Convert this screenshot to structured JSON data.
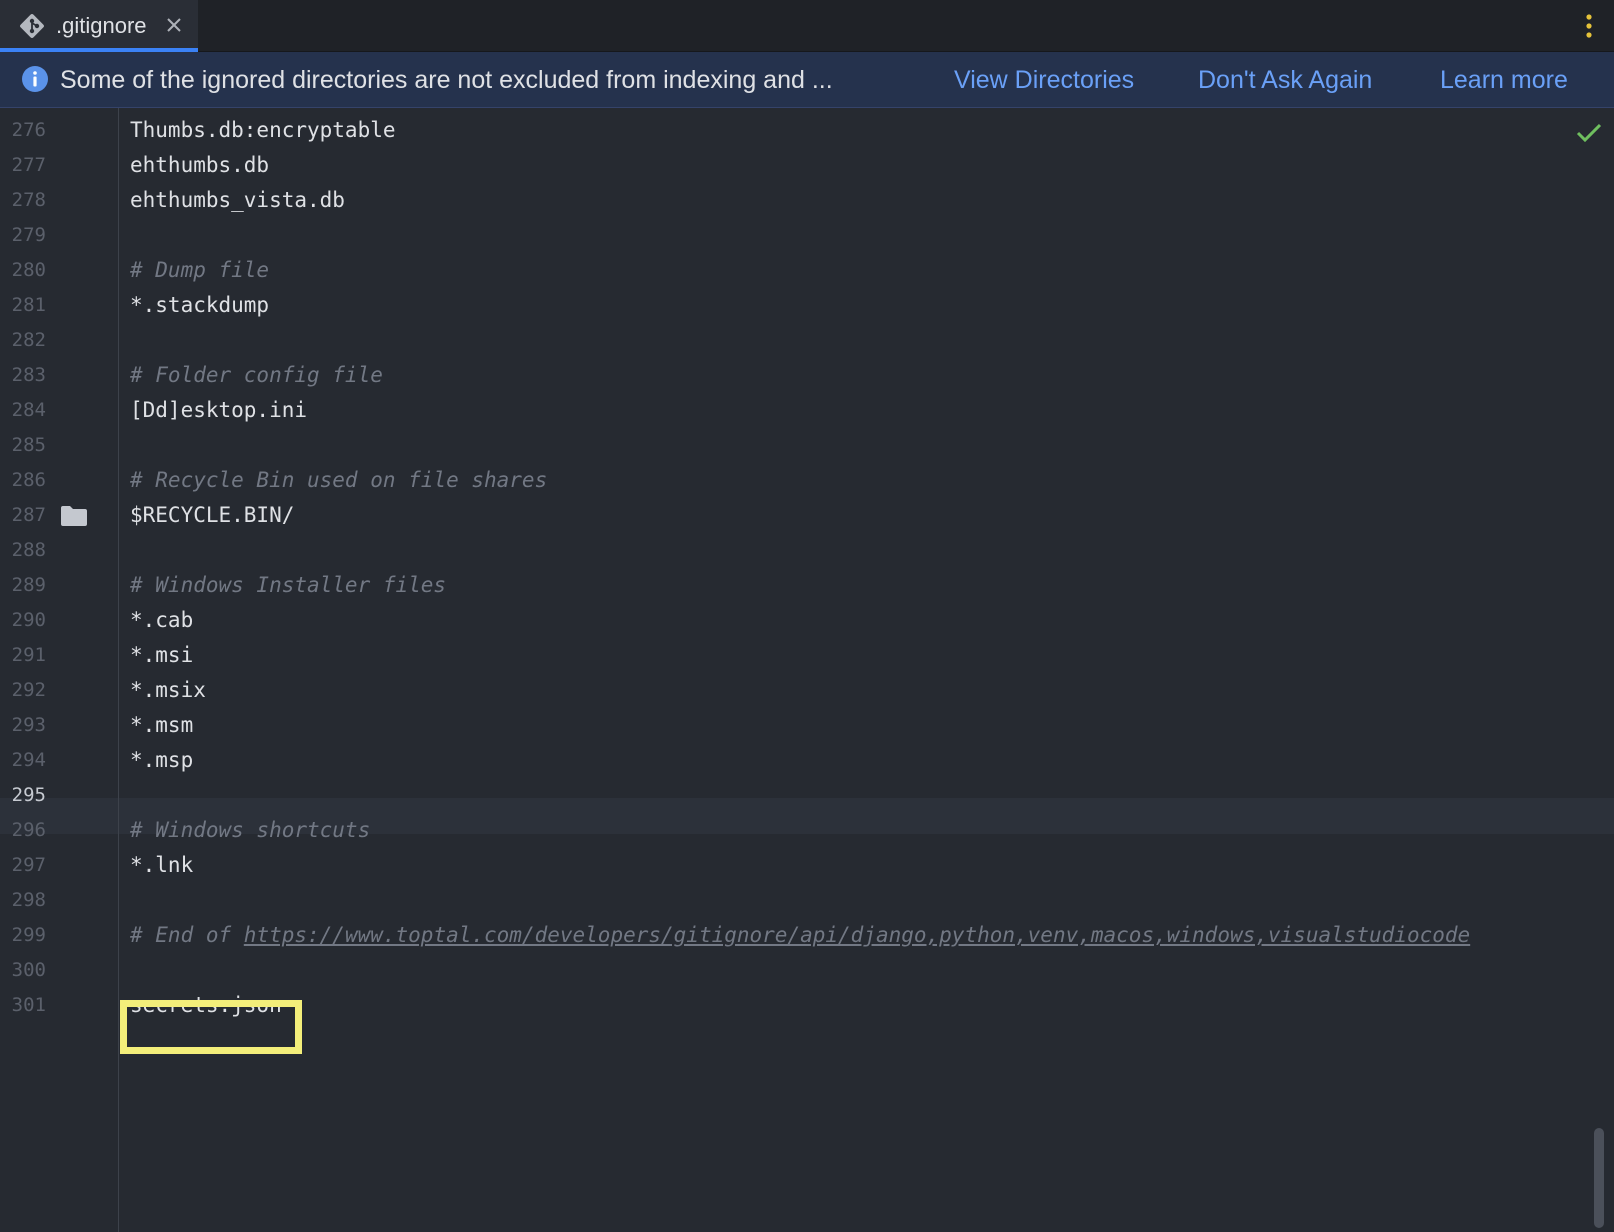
{
  "tab": {
    "label": ".gitignore",
    "icon": "git-icon"
  },
  "banner": {
    "message": "Some of the ignored directories are not excluded from indexing and ...",
    "links": [
      "View Directories",
      "Don't Ask Again",
      "Learn more"
    ]
  },
  "editor": {
    "current_line": "295",
    "lines": [
      {
        "n": "276",
        "text": "Thumbs.db:encryptable",
        "kind": "code"
      },
      {
        "n": "277",
        "text": "ehthumbs.db",
        "kind": "code"
      },
      {
        "n": "278",
        "text": "ehthumbs_vista.db",
        "kind": "code"
      },
      {
        "n": "279",
        "text": "",
        "kind": "code"
      },
      {
        "n": "280",
        "text": "# Dump file",
        "kind": "comment"
      },
      {
        "n": "281",
        "text": "*.stackdump",
        "kind": "code"
      },
      {
        "n": "282",
        "text": "",
        "kind": "code"
      },
      {
        "n": "283",
        "text": "# Folder config file",
        "kind": "comment"
      },
      {
        "n": "284",
        "text": "[Dd]esktop.ini",
        "kind": "code"
      },
      {
        "n": "285",
        "text": "",
        "kind": "code"
      },
      {
        "n": "286",
        "text": "# Recycle Bin used on file shares",
        "kind": "comment"
      },
      {
        "n": "287",
        "text": "$RECYCLE.BIN/",
        "kind": "code"
      },
      {
        "n": "288",
        "text": "",
        "kind": "code"
      },
      {
        "n": "289",
        "text": "# Windows Installer files",
        "kind": "comment"
      },
      {
        "n": "290",
        "text": "*.cab",
        "kind": "code"
      },
      {
        "n": "291",
        "text": "*.msi",
        "kind": "code"
      },
      {
        "n": "292",
        "text": "*.msix",
        "kind": "code"
      },
      {
        "n": "293",
        "text": "*.msm",
        "kind": "code"
      },
      {
        "n": "294",
        "text": "*.msp",
        "kind": "code"
      },
      {
        "n": "295",
        "text": "",
        "kind": "code"
      },
      {
        "n": "296",
        "text": "# Windows shortcuts",
        "kind": "comment"
      },
      {
        "n": "297",
        "text": "*.lnk",
        "kind": "code"
      },
      {
        "n": "298",
        "text": "",
        "kind": "code"
      },
      {
        "n": "299",
        "text": "# End of ",
        "kind": "comment",
        "url": "https://www.toptal.com/developers/gitignore/api/django,python,venv,macos,windows,visualstudiocode"
      },
      {
        "n": "300",
        "text": "",
        "kind": "code"
      },
      {
        "n": "301",
        "text": "secrets.json",
        "kind": "code"
      }
    ]
  },
  "colors": {
    "tab_underline": "#3b82f6",
    "banner_link": "#6aa0f7",
    "highlight": "#f3ee7a",
    "check": "#6fbf5f"
  }
}
